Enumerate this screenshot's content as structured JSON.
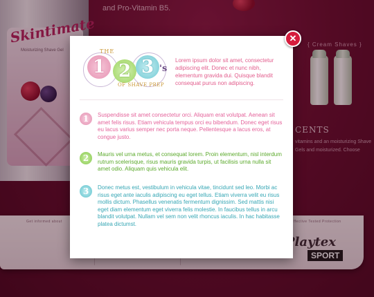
{
  "background": {
    "top_text": "and Pro-Vitamin B5.",
    "can_brand": "Skintimate",
    "can_subtext": "Moisturizing Shave Gel",
    "shelf_title": "{ Cream Shaves }",
    "side_heading": "CENTS",
    "side_copy": "vitamins and an moisturizing Shave Gels and moisturized. Choose",
    "band_label_left": "Get informed about",
    "band_label_right": "Effective Tested Protection",
    "playtex_logo": "Playtex",
    "sport_logo": "SPORT"
  },
  "modal": {
    "close_label": "✕",
    "logo": {
      "the": "THE",
      "n1": "1",
      "n2": "2",
      "n3": "3",
      "suffix": "'s",
      "tagline": "OF SHAVE PREP"
    },
    "intro": "Lorem ipsum dolor sit amet, consectetur adipiscing elit. Donec et nunc nibh, elementum gravida dui. Quisque blandit consequat purus non adipiscing.",
    "steps": [
      {
        "number": "1",
        "text": "Suspendisse sit amet consectetur orci. Aliquam erat volutpat. Aenean sit amet felis risus. Etiam vehicula tempus orci eu bibendum. Donec eget risus eu lacus varius semper nec porta neque. Pellentesque a lacus eros, at congue justo."
      },
      {
        "number": "2",
        "text": "Mauris vel urna metus, et consequat lorem. Proin elementum, nisl interdum rutrum scelerisque, risus mauris gravida turpis, ut facilisis urna nulla sit amet odio. Aliquam quis vehicula elit."
      },
      {
        "number": "3",
        "text": "Donec metus est, vestibulum in vehicula vitae, tincidunt sed leo. Morbi ac risus eget ante iaculis adipiscing eu eget tellus. Etiam viverra velit eu risus mollis dictum. Phasellus venenatis fermentum dignissim. Sed mattis nisi eget diam elementum eget viverra felis molestie. In faucibus tellus in arcu blandit volutpat. Nullam vel sem non velit rhoncus iaculis. In hac habitasse platea dictumst."
      }
    ]
  },
  "colors": {
    "accent_pink": "#e4629a",
    "accent_green": "#5aa92a",
    "accent_teal": "#35a6b4",
    "close_red": "#d61c3d",
    "page_bg": "#6e1130"
  }
}
